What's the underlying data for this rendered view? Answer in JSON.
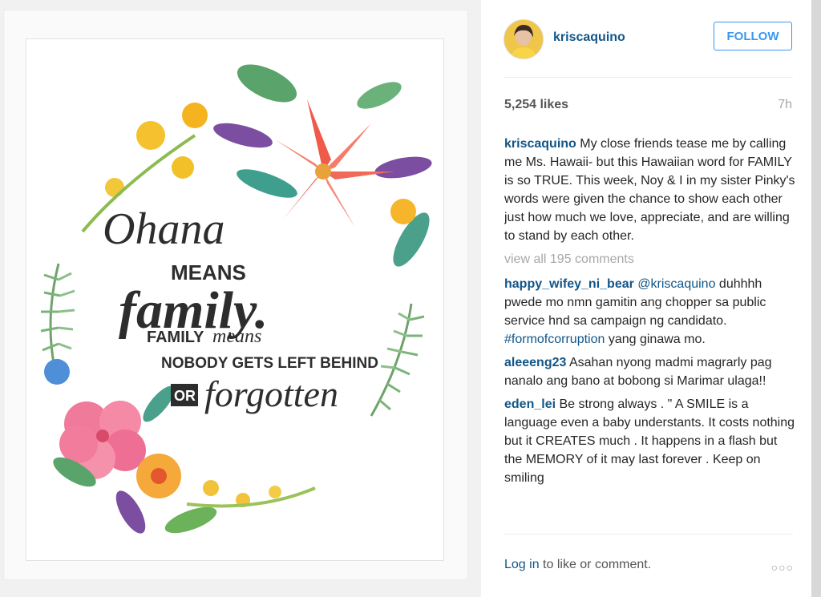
{
  "post": {
    "image_text": {
      "line1": "Ohana",
      "line2": "MEANS",
      "line3": "family.",
      "line4a": "FAMILY",
      "line4b": "means",
      "line5": "NOBODY GETS LEFT BEHIND",
      "line6a": "OR",
      "line6b": "forgotten"
    }
  },
  "user": {
    "username": "kriscaquino",
    "follow_label": "FOLLOW"
  },
  "stats": {
    "likes": "5,254 likes",
    "time": "7h"
  },
  "caption": {
    "user": "kriscaquino",
    "text": " My close friends tease me by calling me Ms. Hawaii- but this Hawaiian word for FAMILY is so TRUE. This week, Noy & I in my sister Pinky's words were given the chance to show each other just how much we love, appreciate, and are willing to stand by each other."
  },
  "view_all": "view all 195 comments",
  "comments": [
    {
      "user": "happy_wifey_ni_bear",
      "mention": "@kriscaquino",
      "text1": " duhhhh pwede mo nmn gamitin ang chopper sa public service hnd sa campaign ng candidato. ",
      "tag": "#formofcorruption",
      "text2": " yang ginawa mo."
    },
    {
      "user": "aleeeng23",
      "text": " Asahan nyong madmi magrarly pag nanalo ang bano at bobong si Marimar ulaga!!"
    },
    {
      "user": "eden_lei",
      "text": " Be strong always . \" A SMILE is a language even a baby understants. It costs nothing but it CREATES much . It happens in a flash but the MEMORY of it may last forever . Keep on smiling"
    }
  ],
  "footer": {
    "login": "Log in",
    "rest": " to like or comment.",
    "more": "○○○"
  },
  "colors": {
    "link": "#125688",
    "follow": "#3897f0",
    "muted": "#a5a7aa"
  }
}
